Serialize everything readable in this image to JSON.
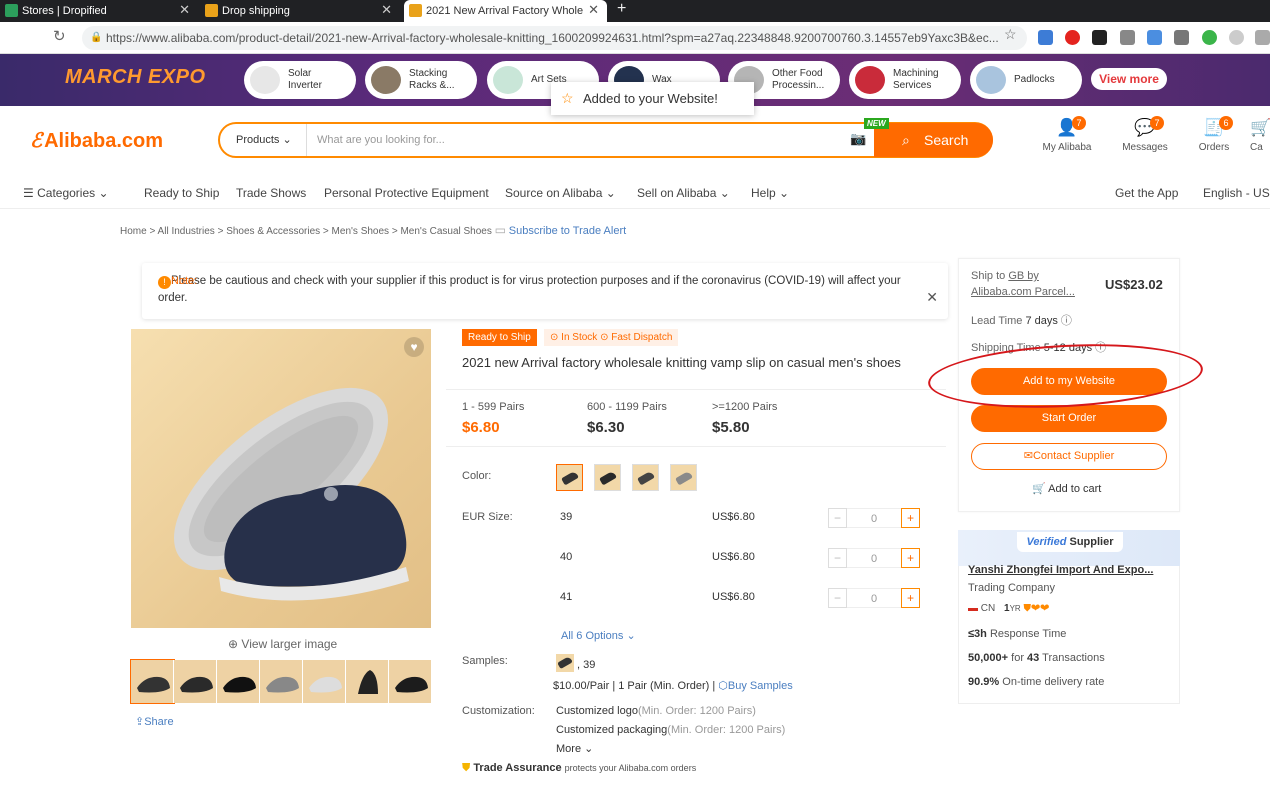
{
  "browser": {
    "tabs": [
      {
        "title": "Stores | Dropified"
      },
      {
        "title": "Drop shipping"
      },
      {
        "title": "2021 New Arrival Factory Whole"
      }
    ],
    "url": "https://www.alibaba.com/product-detail/2021-new-Arrival-factory-wholesale-knitting_1600209924631.html?spm=a27aq.22348848.9200700760.3.14557eb9Yaxc3B&ec..."
  },
  "expo": {
    "title": "MARCH EXPO",
    "chips": [
      {
        "l1": "Solar",
        "l2": "Inverter"
      },
      {
        "l1": "Stacking",
        "l2": "Racks &..."
      },
      {
        "l1": "Art Sets",
        "l2": ""
      },
      {
        "l1": "Wax",
        "l2": ""
      },
      {
        "l1": "Other Food",
        "l2": "Processin..."
      },
      {
        "l1": "Machining",
        "l2": "Services"
      },
      {
        "l1": "Padlocks",
        "l2": ""
      }
    ],
    "view_more": "View more"
  },
  "toast": "Added to your Website!",
  "header": {
    "logo": "Alibaba.com",
    "search_category": "Products",
    "search_placeholder": "What are you looking for...",
    "new_badge": "NEW",
    "search_button": "Search",
    "icons": [
      {
        "label": "My Alibaba",
        "badge": "7"
      },
      {
        "label": "Messages",
        "badge": "7"
      },
      {
        "label": "Orders",
        "badge": "6"
      },
      {
        "label": "Ca",
        "badge": ""
      }
    ]
  },
  "nav": {
    "categories": "Categories",
    "items": [
      "Ready to Ship",
      "Trade Shows",
      "Personal Protective Equipment",
      "Source on Alibaba",
      "Sell on Alibaba",
      "Help"
    ],
    "get_app": "Get the App",
    "lang": "English - USD"
  },
  "breadcrumb": [
    "Home",
    "All Industries",
    "Shoes & Accessories",
    "Men's Shoes",
    "Men's Casual Shoes"
  ],
  "subscribe": "Subscribe to Trade Alert",
  "notice": {
    "label": "Note:",
    "text": "Please be cautious and check with your supplier if this product is for virus protection purposes and if the coronavirus (COVID-19) will affect your order."
  },
  "gallery": {
    "view_larger": "View larger image",
    "share": "Share"
  },
  "product": {
    "tag_ready": "Ready to Ship",
    "tag_stock": "In Stock",
    "tag_dispatch": "Fast Dispatch",
    "title": "2021 new Arrival factory wholesale knitting vamp slip on casual men's shoes",
    "tiers": [
      {
        "qty": "1 - 599 Pairs",
        "price": "$6.80"
      },
      {
        "qty": "600 - 1199 Pairs",
        "price": "$6.30"
      },
      {
        "qty": ">=1200 Pairs",
        "price": "$5.80"
      }
    ],
    "color_label": "Color:",
    "size_label": "EUR Size:",
    "sizes": [
      {
        "size": "39",
        "price": "US$6.80",
        "qty": "0"
      },
      {
        "size": "40",
        "price": "US$6.80",
        "qty": "0"
      },
      {
        "size": "41",
        "price": "US$6.80",
        "qty": "0"
      }
    ],
    "all_options": "All 6 Options",
    "samples_label": "Samples:",
    "sample_size": ", 39",
    "sample_price": "$10.00/Pair | 1 Pair (Min. Order) |",
    "buy_samples": "Buy Samples",
    "custom_label": "Customization:",
    "custom_logo": "Customized logo",
    "custom_logo_min": "(Min. Order: 1200 Pairs)",
    "custom_pack": "Customized packaging",
    "custom_pack_min": "(Min. Order: 1200 Pairs)",
    "more": "More",
    "trade_assurance": "Trade Assurance",
    "trade_assurance_sub": "protects your Alibaba.com orders"
  },
  "buybox": {
    "ship_to": "Ship to",
    "ship_dest": "GB by",
    "ship_method": "Alibaba.com Parcel...",
    "ship_price": "US$23.02",
    "lead_time_label": "Lead Time",
    "lead_time": "7 days",
    "shipping_time_label": "Shipping Time",
    "shipping_time": "5-12 days",
    "add_website": "Add to my Website",
    "start_order": "Start Order",
    "contact": "Contact Supplier",
    "add_cart": "Add to cart"
  },
  "supplier": {
    "verified_v": "Verified",
    "verified": "Supplier",
    "name": "Yanshi Zhongfei Import And Expo...",
    "type": "Trading Company",
    "country": "CN",
    "years": "1",
    "years_unit": "YR",
    "response_val": "≤3h",
    "response_label": "Response Time",
    "transactions_val": "50,000+",
    "transactions_mid": "for",
    "transactions_num": "43",
    "transactions_label": "Transactions",
    "ontime_val": "90.9%",
    "ontime_label": "On-time delivery rate"
  },
  "colors": {
    "accent": "#ff6a00",
    "link": "#4a7ec0",
    "annotation": "#d5171b"
  }
}
